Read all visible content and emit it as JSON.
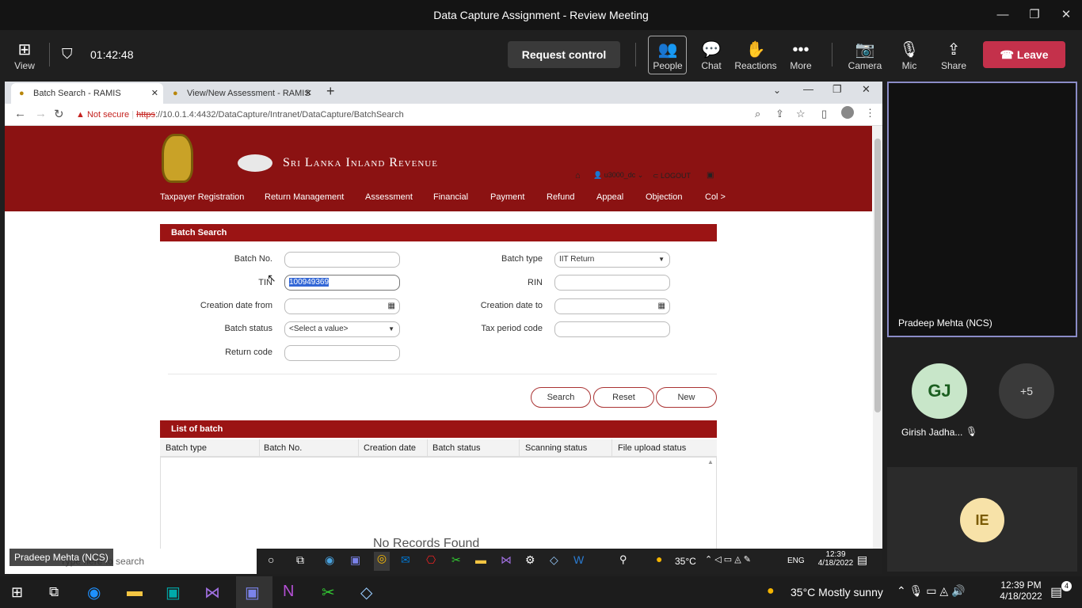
{
  "meeting": {
    "title": "Data Capture Assignment - Review Meeting",
    "view_label": "View",
    "timer": "01:42:48",
    "request_control": "Request control",
    "people": "People",
    "chat": "Chat",
    "reactions": "Reactions",
    "more": "More",
    "camera": "Camera",
    "mic": "Mic",
    "share": "Share",
    "leave": "Leave"
  },
  "browser": {
    "tabs": [
      {
        "label": "Batch Search - RAMIS"
      },
      {
        "label": "View/New Assessment - RAMIS"
      }
    ],
    "not_secure": "Not secure",
    "url_scheme": "https",
    "url_rest": "://10.0.1.4:4432/DataCapture/Intranet/DataCapture/BatchSearch"
  },
  "site": {
    "brand": "Sri Lanka Inland Revenue",
    "user": "u3000_dc",
    "logout": "LOGOUT",
    "nav": [
      "Taxpayer Registration",
      "Return Management",
      "Assessment",
      "Financial",
      "Payment",
      "Refund",
      "Appeal",
      "Objection",
      "Col >"
    ]
  },
  "search_panel": {
    "title": "Batch Search",
    "batch_no_label": "Batch No.",
    "tin_label": "TIN",
    "tin_value": "100949369",
    "creation_from_label": "Creation date from",
    "batch_status_label": "Batch status",
    "batch_status_value": "<Select a value>",
    "return_code_label": "Return code",
    "batch_type_label": "Batch type",
    "batch_type_value": "IIT Return",
    "rin_label": "RIN",
    "creation_to_label": "Creation date to",
    "tax_period_label": "Tax period code",
    "search_btn": "Search",
    "reset_btn": "Reset",
    "new_btn": "New"
  },
  "list_panel": {
    "title": "List of batch",
    "columns": [
      "Batch type",
      "Batch No.",
      "Creation date",
      "Batch status",
      "Scanning status",
      "File upload status"
    ],
    "empty": "No Records Found"
  },
  "participants": {
    "main_name": "Pradeep Mehta (NCS)",
    "gj_initials": "GJ",
    "gj_name": "Girish Jadha...",
    "more_count": "+5",
    "ie_initials": "IE",
    "overlay_name": "Pradeep Mehta (NCS)"
  },
  "inner_taskbar": {
    "search_placeholder": "Type here to search",
    "temp": "35°C",
    "lang": "ENG",
    "time": "12:39",
    "date": "4/18/2022"
  },
  "taskbar": {
    "weather": "35°C  Mostly sunny",
    "time": "12:39 PM",
    "date": "4/18/2022",
    "notif_count": "4"
  }
}
